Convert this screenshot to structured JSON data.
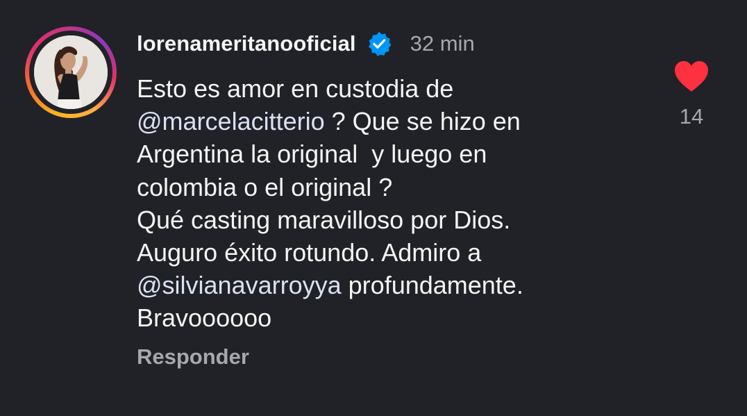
{
  "comment": {
    "username": "lorenameritanooficial",
    "time": "32 min",
    "lines": [
      {
        "segments": [
          {
            "type": "text",
            "text": "Esto es amor en custodia de"
          }
        ]
      },
      {
        "segments": [
          {
            "type": "mention",
            "text": "@marcelacitterio"
          },
          {
            "type": "text",
            "text": " ? Que se hizo en"
          }
        ]
      },
      {
        "segments": [
          {
            "type": "text",
            "text": "Argentina la original  y luego en"
          }
        ]
      },
      {
        "segments": [
          {
            "type": "text",
            "text": "colombia o el original ?"
          }
        ]
      },
      {
        "segments": [
          {
            "type": "text",
            "text": "Qué casting maravilloso por Dios."
          }
        ]
      },
      {
        "segments": [
          {
            "type": "text",
            "text": "Auguro éxito rotundo. Admiro a"
          }
        ]
      },
      {
        "segments": [
          {
            "type": "mention",
            "text": "@silvianavarroyya"
          },
          {
            "type": "text",
            "text": " profundamente."
          }
        ]
      },
      {
        "segments": [
          {
            "type": "text",
            "text": "Bravoooooo"
          }
        ]
      }
    ],
    "reply_label": "Responder",
    "like_count": "14",
    "liked": true
  },
  "colors": {
    "background": "#212227",
    "text": "#f5f5f5",
    "muted": "#a7a8ad",
    "mention": "#dbe1f4",
    "heart": "#ff3040",
    "verified": "#0095f6"
  },
  "icons": {
    "verified": "verified-badge-icon",
    "like": "heart-icon",
    "avatar": "avatar"
  }
}
